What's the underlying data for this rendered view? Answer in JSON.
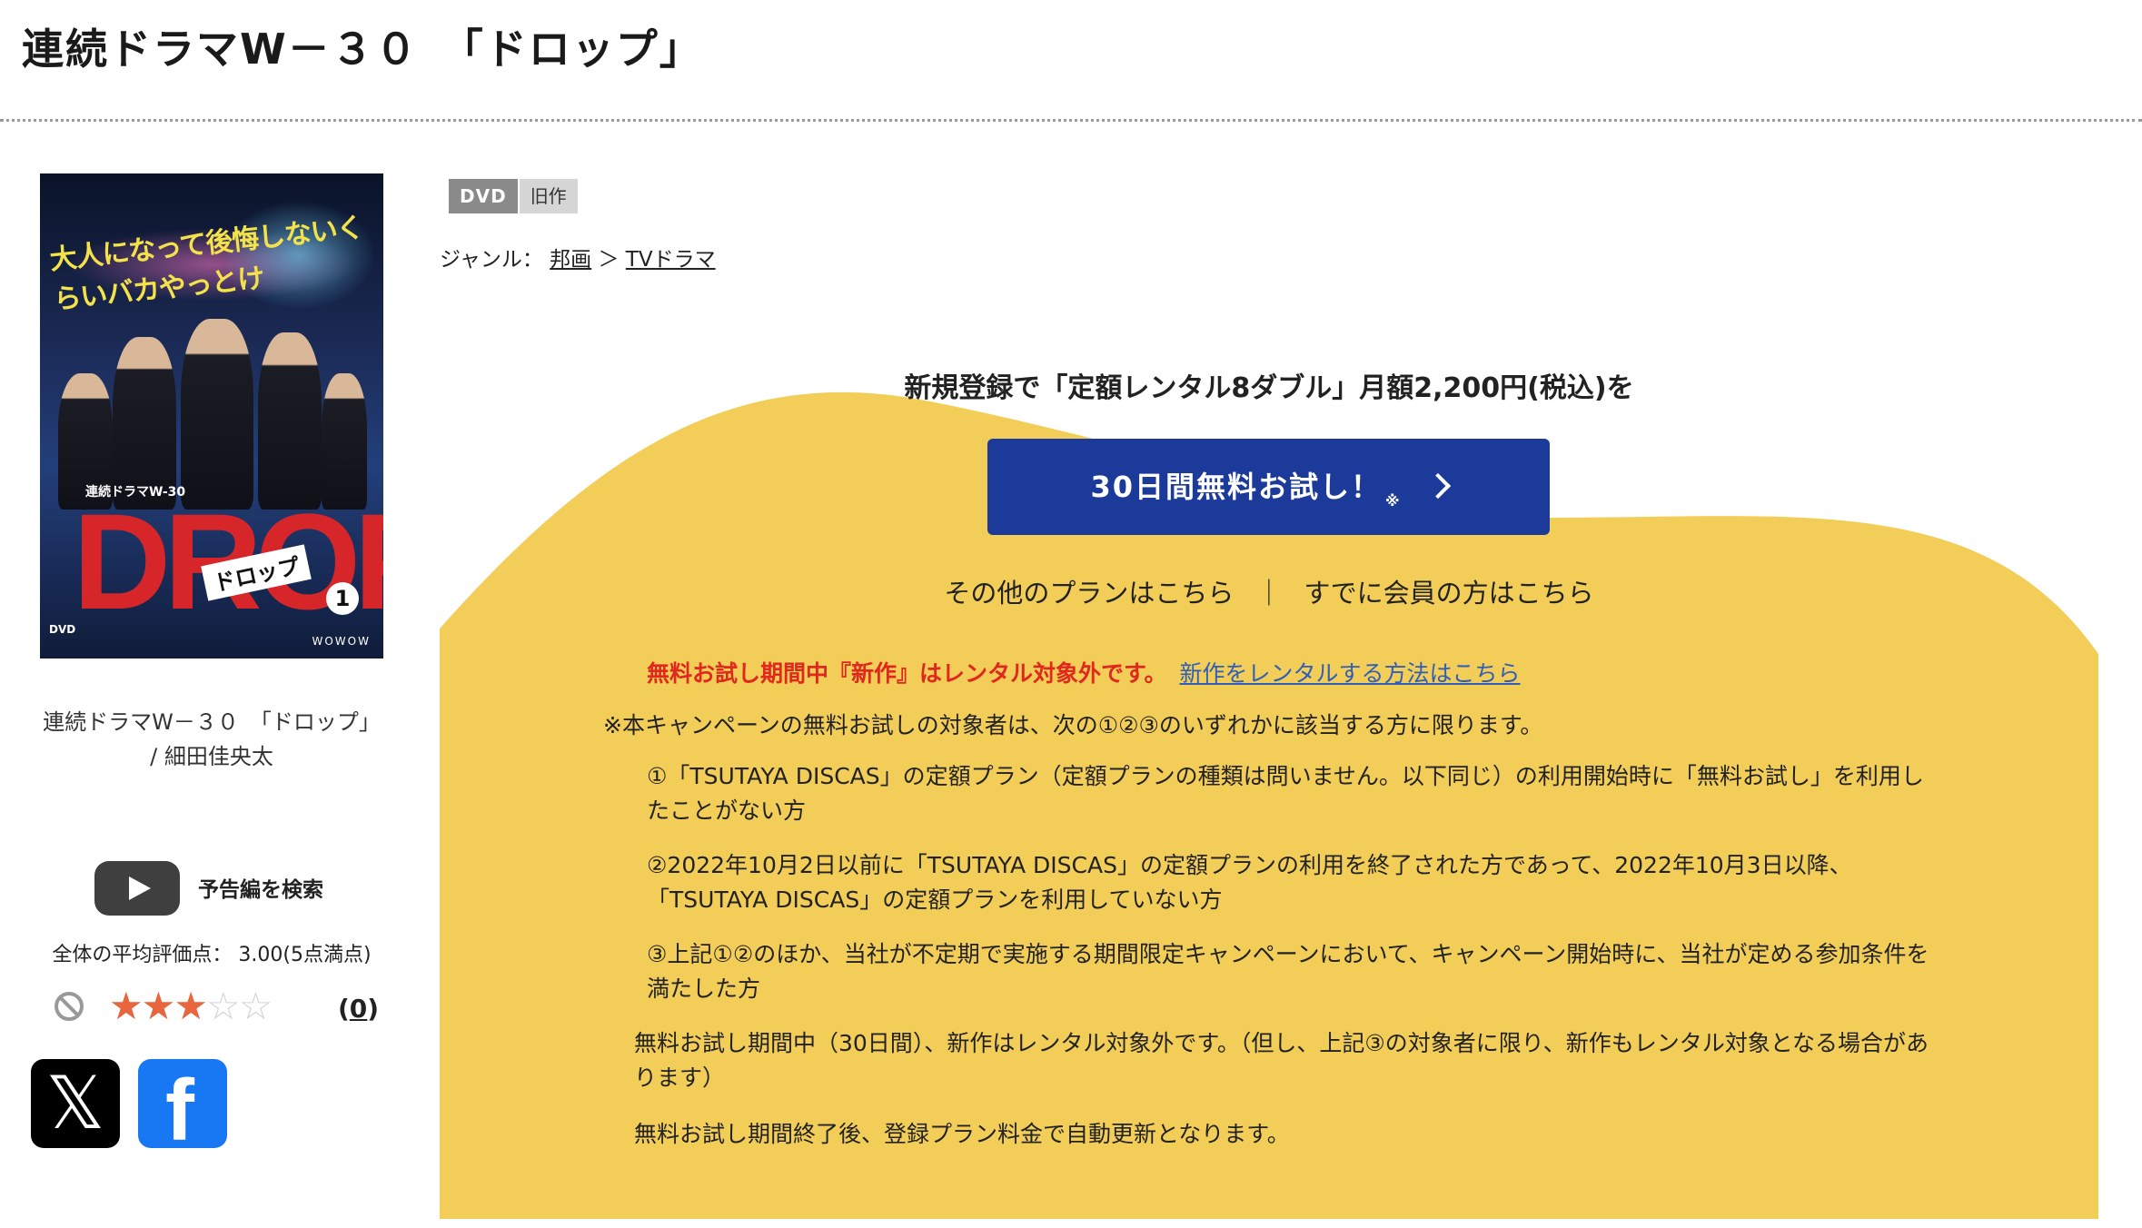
{
  "header": {
    "title": "連続ドラマW－３０　「ドロップ」"
  },
  "cover": {
    "scribble": "大人になって後悔しないくらいバカやっとけ",
    "series_small": "連続ドラマW-30",
    "logo": "DROP",
    "logo_katakana": "ドロップ",
    "volume": "1",
    "disc_mark": "DVD",
    "network": "WOWOW"
  },
  "product": {
    "caption": "連続ドラマW－３０　「ドロップ」 / 細田佳央太",
    "trailer_label": "予告編を検索",
    "rating_text": "全体の平均評価点： 3.00(5点満点)",
    "rating_value": 3,
    "rating_max": 5,
    "review_count_open": "(",
    "review_count": "0",
    "review_count_close": ")",
    "stars": [
      "★",
      "★",
      "★",
      "☆",
      "☆"
    ]
  },
  "share": {
    "x_label": "𝕏",
    "facebook_label": "f"
  },
  "badges": {
    "format": "DVD",
    "status": "旧作"
  },
  "genre": {
    "label": "ジャンル：",
    "items": [
      "邦画",
      "TVドラマ"
    ],
    "separator": "＞"
  },
  "promo": {
    "headline": "新規登録で「定額レンタル8ダブル」月額2,200円(税込)を",
    "button_label": "30日間無料お試し！",
    "button_mark": "※",
    "other_plans": "その他のプランはこちら",
    "divider": "｜",
    "members": "すでに会員の方はこちら",
    "notice_red": "無料お試し期間中『新作』はレンタル対象外です。",
    "notice_link": "新作をレンタルする方法はこちら",
    "lead": "※本キャンペーンの無料お試しの対象者は、次の①②③のいずれかに該当する方に限ります。",
    "conditions": [
      "①「TSUTAYA DISCAS」の定額プラン（定額プランの種類は問いません。以下同じ）の利用開始時に「無料お試し」を利用したことがない方",
      "②2022年10月2日以前に「TSUTAYA DISCAS」の定額プランの利用を終了された方であって、2022年10月3日以降、「TSUTAYA DISCAS」の定額プランを利用していない方",
      "③上記①②のほか、当社が不定期で実施する期間限定キャンペーンにおいて、キャンペーン開始時に、当社が定める参加条件を満たした方"
    ],
    "trial_note": "無料お試し期間中（30日間）、新作はレンタル対象外です。（但し、上記③の対象者に限り、新作もレンタル対象となる場合があります）",
    "renew_note": "無料お試し期間終了後、登録プラン料金で自動更新となります。"
  },
  "colors": {
    "yellow": "#f2cd58",
    "button_blue": "#1b3a9a",
    "notice_red": "#e0281e",
    "link_blue": "#2f5fb8",
    "star_on": "#e8663e"
  }
}
